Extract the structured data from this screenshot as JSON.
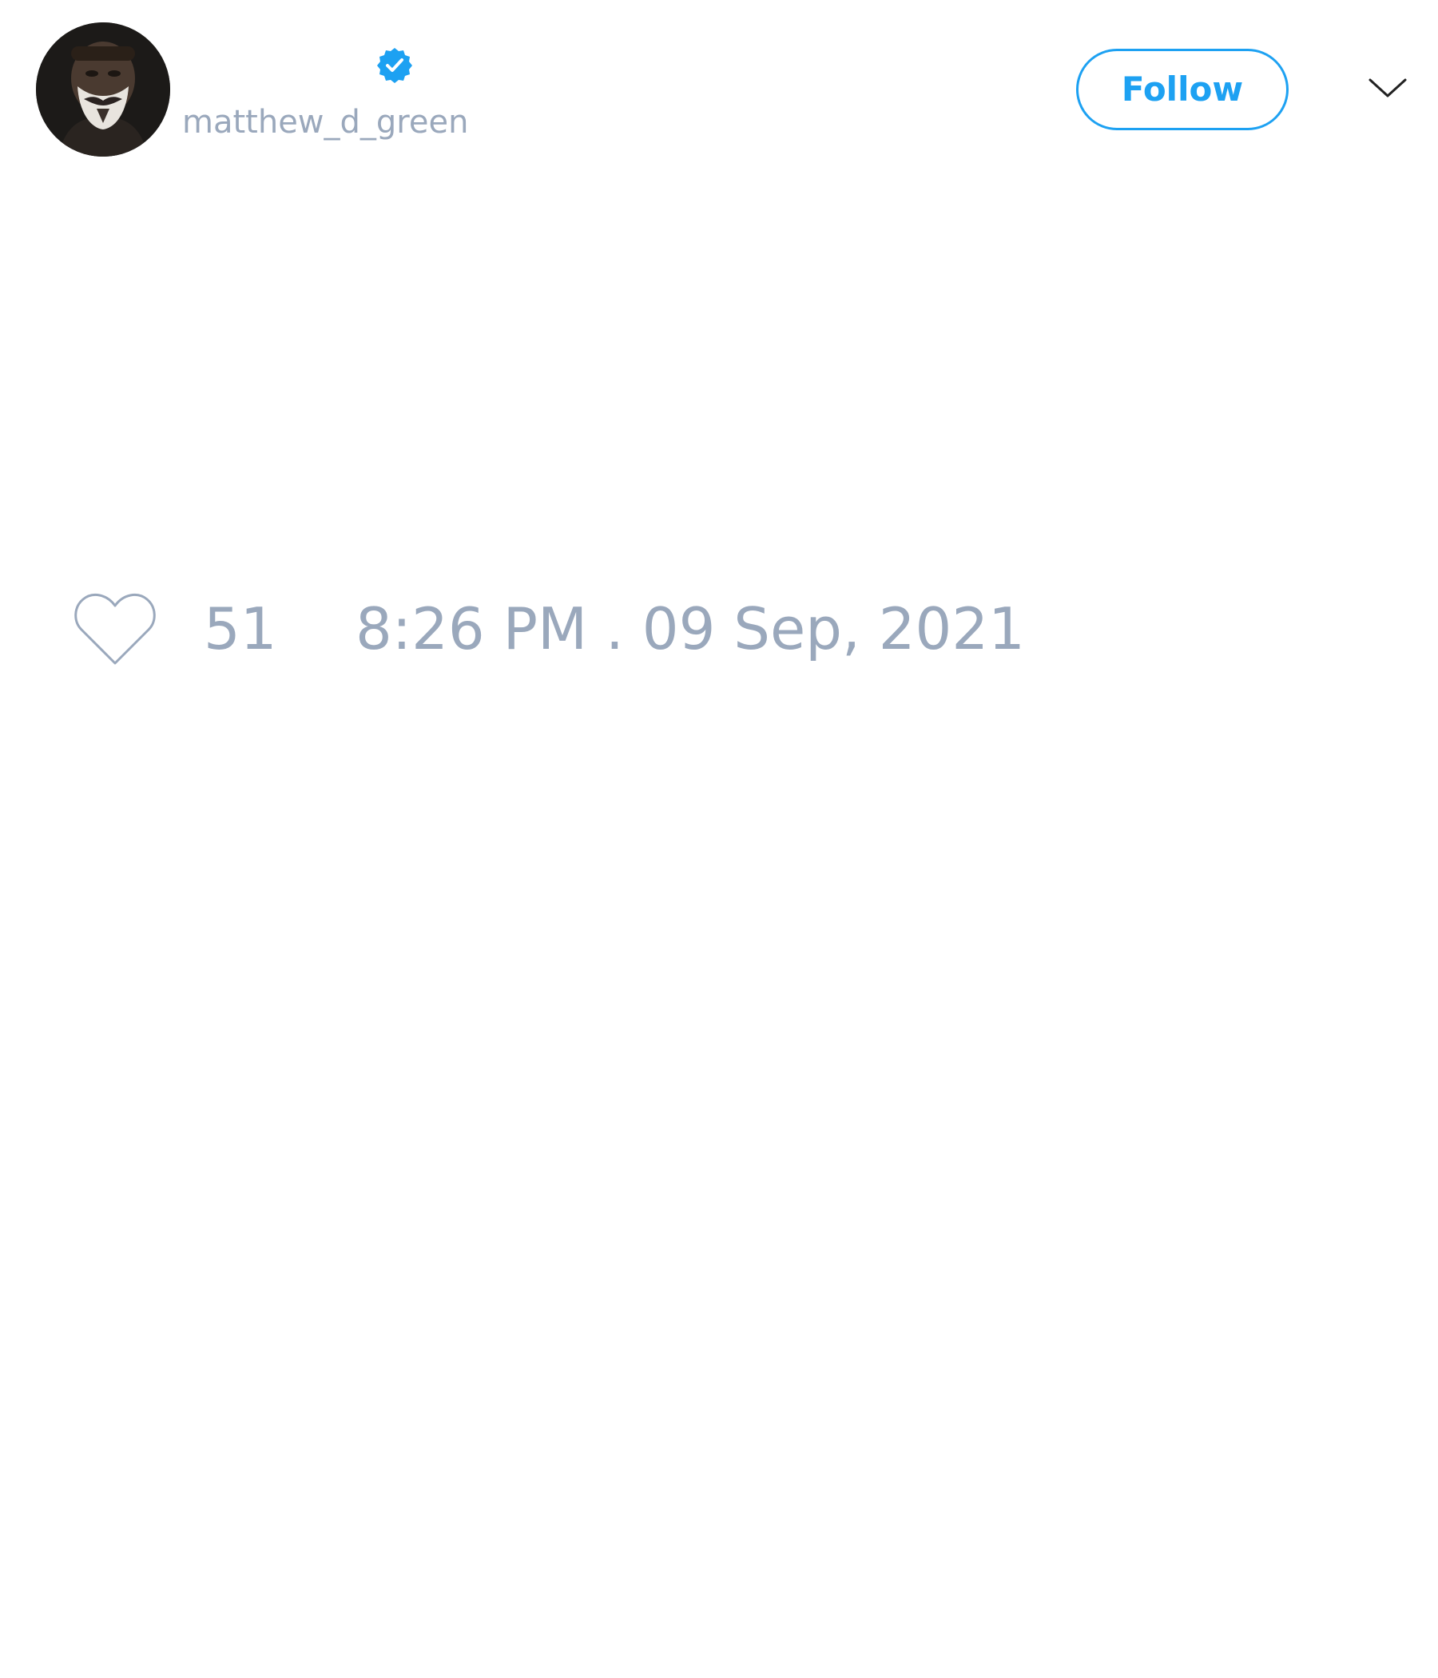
{
  "tweet": {
    "author": {
      "username": "matthew_d_green",
      "verified": true,
      "avatar_icon": "masked-person-avatar"
    },
    "follow_label": "Follow",
    "menu_icon": "chevron-down-icon",
    "like_icon": "heart-outline-icon",
    "like_count": "51",
    "timestamp": "8:26 PM . 09 Sep, 2021"
  },
  "colors": {
    "accent": "#1da1f2",
    "muted_text": "#9aa8bc",
    "icon_gray": "#9aa8bc",
    "background": "#ffffff"
  }
}
